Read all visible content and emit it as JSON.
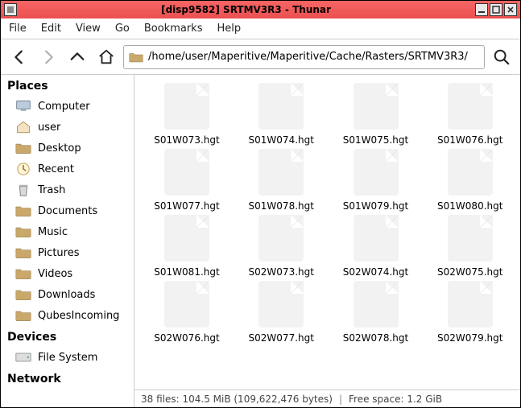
{
  "window": {
    "title": "[disp9582] SRTMV3R3 - Thunar"
  },
  "menu": {
    "file": "File",
    "edit": "Edit",
    "view": "View",
    "go": "Go",
    "bookmarks": "Bookmarks",
    "help": "Help"
  },
  "toolbar": {
    "path": "/home/user/Maperitive/Maperitive/Cache/Rasters/SRTMV3R3/"
  },
  "sidebar": {
    "places_label": "Places",
    "devices_label": "Devices",
    "network_label": "Network",
    "places": [
      {
        "label": "Computer"
      },
      {
        "label": "user"
      },
      {
        "label": "Desktop"
      },
      {
        "label": "Recent"
      },
      {
        "label": "Trash"
      },
      {
        "label": "Documents"
      },
      {
        "label": "Music"
      },
      {
        "label": "Pictures"
      },
      {
        "label": "Videos"
      },
      {
        "label": "Downloads"
      },
      {
        "label": "QubesIncoming"
      }
    ],
    "devices": [
      {
        "label": "File System"
      }
    ]
  },
  "files": [
    {
      "name": "S01W073.hgt"
    },
    {
      "name": "S01W074.hgt"
    },
    {
      "name": "S01W075.hgt"
    },
    {
      "name": "S01W076.hgt"
    },
    {
      "name": "S01W077.hgt"
    },
    {
      "name": "S01W078.hgt"
    },
    {
      "name": "S01W079.hgt"
    },
    {
      "name": "S01W080.hgt"
    },
    {
      "name": "S01W081.hgt"
    },
    {
      "name": "S02W073.hgt"
    },
    {
      "name": "S02W074.hgt"
    },
    {
      "name": "S02W075.hgt"
    },
    {
      "name": "S02W076.hgt"
    },
    {
      "name": "S02W077.hgt"
    },
    {
      "name": "S02W078.hgt"
    },
    {
      "name": "S02W079.hgt"
    }
  ],
  "status": {
    "left": "38 files: 104.5 MiB (109,622,476 bytes)",
    "right": "Free space: 1.2 GiB"
  }
}
